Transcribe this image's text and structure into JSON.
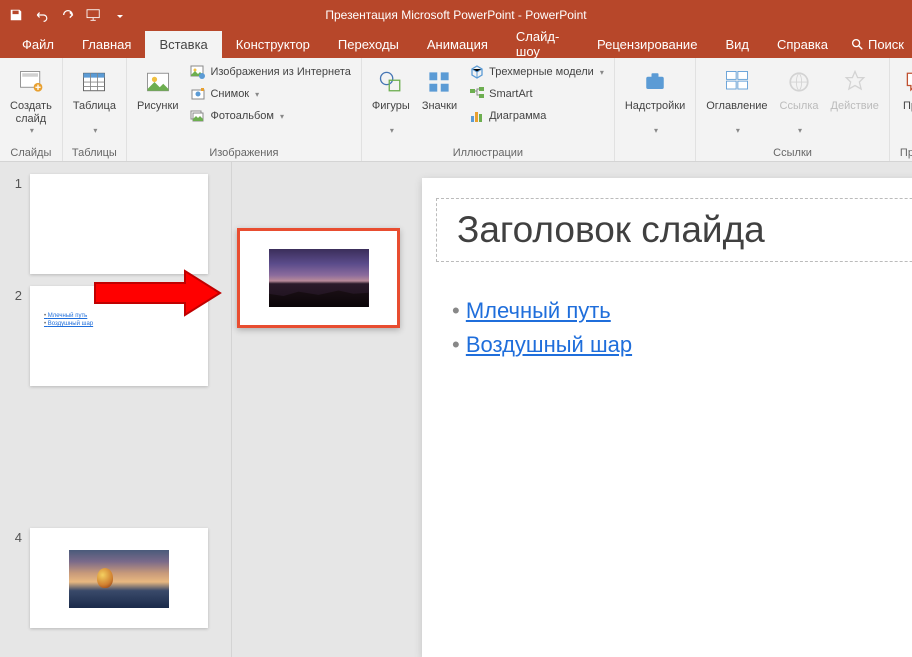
{
  "title": "Презентация Microsoft PowerPoint  -  PowerPoint",
  "menu": {
    "file": "Файл",
    "home": "Главная",
    "insert": "Вставка",
    "design": "Конструктор",
    "transitions": "Переходы",
    "animations": "Анимация",
    "slideshow": "Слайд-шоу",
    "review": "Рецензирование",
    "view": "Вид",
    "help": "Справка",
    "search": "Поиск"
  },
  "ribbon": {
    "slides": {
      "new_slide": "Создать\nслайд",
      "group": "Слайды"
    },
    "tables": {
      "table": "Таблица",
      "group": "Таблицы"
    },
    "images": {
      "pictures": "Рисунки",
      "online": "Изображения из Интернета",
      "screenshot": "Снимок",
      "album": "Фотоальбом",
      "group": "Изображения"
    },
    "illustrations": {
      "shapes": "Фигуры",
      "icons": "Значки",
      "models": "Трехмерные модели",
      "smartart": "SmartArt",
      "chart": "Диаграмма",
      "group": "Иллюстрации"
    },
    "addins": {
      "addins": "Надстройки",
      "group": ""
    },
    "links": {
      "toc": "Оглавление",
      "link": "Ссылка",
      "action": "Действие",
      "group": "Ссылки"
    },
    "comments": {
      "comment": "Прим",
      "group": "Приме"
    }
  },
  "thumbnails": [
    {
      "num": "1"
    },
    {
      "num": "2",
      "link1": "Млечный путь",
      "link2": "Воздушный шар"
    },
    {
      "num": "4"
    }
  ],
  "slide": {
    "title": "Заголовок слайда",
    "link1": "Млечный путь",
    "link2": "Воздушный шар"
  }
}
